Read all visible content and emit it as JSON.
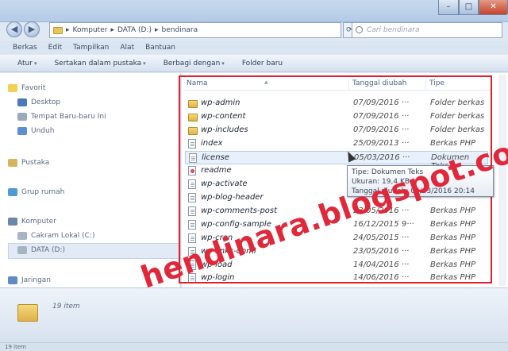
{
  "window": {
    "min_glyph": "–",
    "max_glyph": "□",
    "close_glyph": "✕"
  },
  "nav": {
    "back_glyph": "◀",
    "forward_glyph": "▶",
    "breadcrumb": [
      "Komputer",
      "DATA (D:)",
      "bendinara"
    ],
    "separator": "▸",
    "refresh_glyph": "⟳",
    "search_placeholder": "Cari bendinara"
  },
  "menu": [
    "Berkas",
    "Edit",
    "Tampilkan",
    "Alat",
    "Bantuan"
  ],
  "toolbar": {
    "organize": "Atur",
    "include": "Sertakan dalam pustaka",
    "share": "Berbagi dengan",
    "new_folder": "Folder baru",
    "caret": "▾"
  },
  "navpane": {
    "favorites": "Favorit",
    "desktop": "Desktop",
    "recent": "Tempat Baru-baru Ini",
    "downloads": "Unduh",
    "libraries": "Pustaka",
    "homegroup": "Grup rumah",
    "computer": "Komputer",
    "drive_c": "Cakram Lokal (C:)",
    "drive_d": "DATA (D:)",
    "network": "Jaringan"
  },
  "columns": {
    "name": "Nama",
    "date": "Tanggal diubah",
    "type": "Tipe"
  },
  "files": [
    {
      "name": "wp-admin",
      "date": "07/09/2016",
      "extra": "···",
      "type": "Folder berkas",
      "icon": "folder-icon"
    },
    {
      "name": "wp-content",
      "date": "07/09/2016",
      "extra": "···",
      "type": "Folder berkas",
      "icon": "folder-icon"
    },
    {
      "name": "wp-includes",
      "date": "07/09/2016",
      "extra": "···",
      "type": "Folder berkas",
      "icon": "folder-icon"
    },
    {
      "name": "index",
      "date": "25/09/2013",
      "extra": "···",
      "type": "Berkas PHP",
      "icon": "php-file-icon"
    },
    {
      "name": "license",
      "date": "05/03/2016",
      "extra": "···",
      "type": "Dokumen Teks",
      "icon": "text-file-icon"
    },
    {
      "name": "readme",
      "date": "",
      "extra": "",
      "type": "",
      "icon": "html-file-icon"
    },
    {
      "name": "wp-activate",
      "date": "",
      "extra": "",
      "type": "",
      "icon": "php-file-icon"
    },
    {
      "name": "wp-blog-header",
      "date": "",
      "extra": "",
      "type": "",
      "icon": "php-file-icon"
    },
    {
      "name": "wp-comments-post",
      "date": "23/05/2016",
      "extra": "···",
      "type": "Berkas PHP",
      "icon": "php-file-icon"
    },
    {
      "name": "wp-config-sample",
      "date": "16/12/2015",
      "extra": "9···",
      "type": "Berkas PHP",
      "icon": "php-file-icon"
    },
    {
      "name": "wp-cron",
      "date": "24/05/2015",
      "extra": "···",
      "type": "Berkas PHP",
      "icon": "php-file-icon"
    },
    {
      "name": "wp-links-opml",
      "date": "23/05/2016",
      "extra": "···",
      "type": "Berkas PHP",
      "icon": "php-file-icon"
    },
    {
      "name": "wp-load",
      "date": "14/04/2016",
      "extra": "···",
      "type": "Berkas PHP",
      "icon": "php-file-icon"
    },
    {
      "name": "wp-login",
      "date": "14/06/2016",
      "extra": "···",
      "type": "Berkas PHP",
      "icon": "php-file-icon"
    }
  ],
  "tooltip": {
    "type_line": "Tipe: Dokumen Teks",
    "size_line": "Ukuran: 19,4 KB",
    "date_line": "Tanggal diubah: 05/03/2016 20:14"
  },
  "details": {
    "count": "19 item"
  },
  "status": {
    "count": "19 item"
  },
  "watermark": "hendinara.blogspot.com",
  "colors": {
    "highlight_frame": "#e0202a",
    "watermark": "#e0283a"
  }
}
